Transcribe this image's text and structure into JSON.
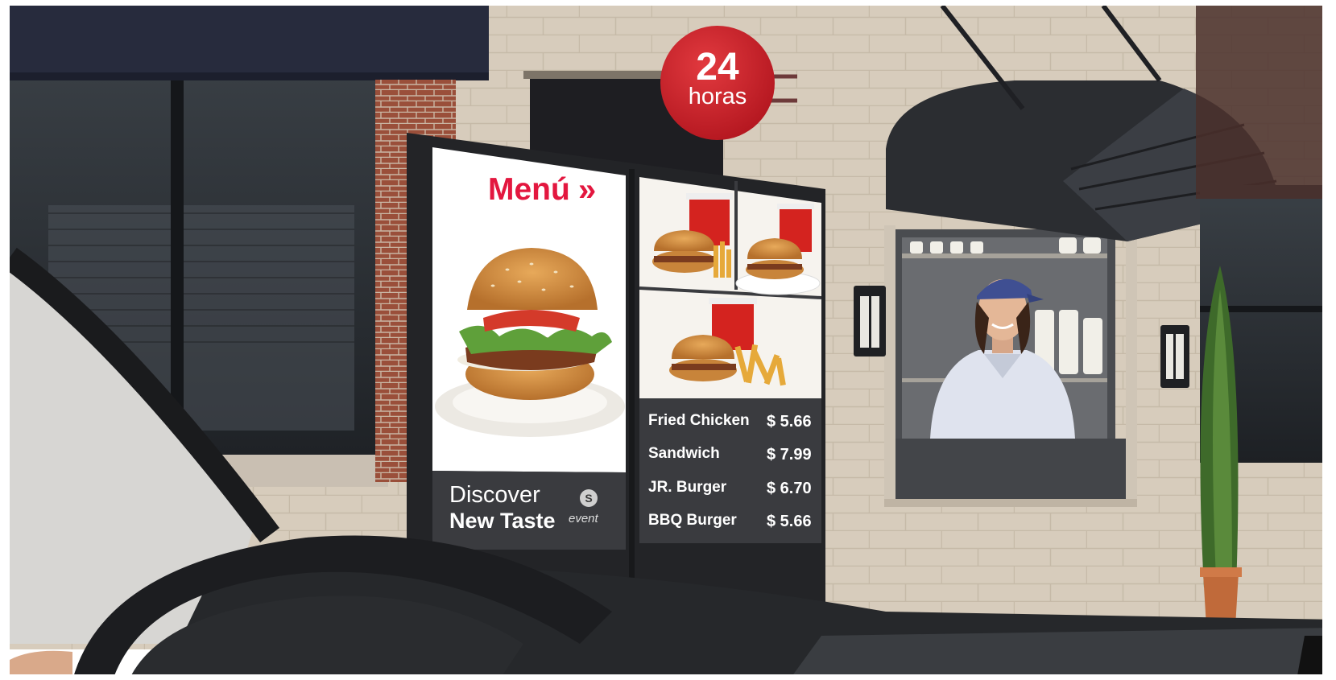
{
  "badge": {
    "number": "24",
    "label": "horas",
    "color": "#d62430"
  },
  "menu_board": {
    "title": "Menú",
    "arrow": "»",
    "promo_line1": "Discover",
    "promo_line2": "New Taste",
    "brand": "event",
    "brand_mark": "S",
    "accent": "#e3173f",
    "items": [
      {
        "name": "Fried Chicken",
        "price": "$ 5.66"
      },
      {
        "name": "Sandwich",
        "price": "$ 7.99"
      },
      {
        "name": "JR. Burger",
        "price": "$ 6.70"
      },
      {
        "name": "BBQ Burger",
        "price": "$ 5.66"
      }
    ]
  },
  "icons": [
    "burger-icon",
    "soda-cup-icon",
    "fries-icon",
    "wall-lamp-icon",
    "steering-wheel-icon"
  ]
}
